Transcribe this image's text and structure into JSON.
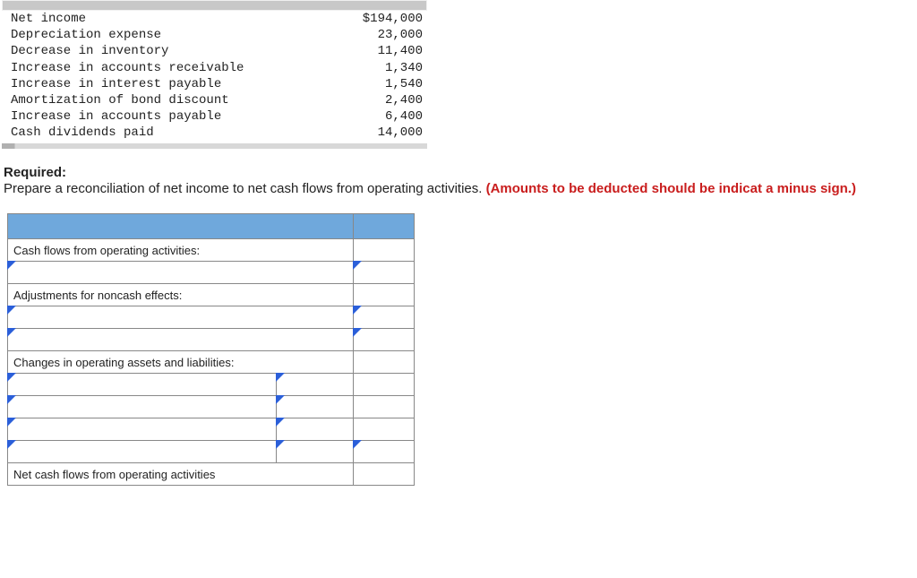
{
  "data_items": [
    {
      "label": "Net income",
      "value": "$194,000"
    },
    {
      "label": "Depreciation expense",
      "value": "23,000"
    },
    {
      "label": "Decrease in inventory",
      "value": "11,400"
    },
    {
      "label": "Increase in accounts receivable",
      "value": "1,340"
    },
    {
      "label": "Increase in interest payable",
      "value": "1,540"
    },
    {
      "label": "Amortization of bond discount",
      "value": "2,400"
    },
    {
      "label": "Increase in accounts payable",
      "value": "6,400"
    },
    {
      "label": "Cash dividends paid",
      "value": "14,000"
    }
  ],
  "required": {
    "heading": "Required:",
    "instruction_plain": "Prepare a reconciliation of net income to net cash flows from operating activities. ",
    "instruction_red": "(Amounts to be deducted should be indicat a minus sign.)"
  },
  "answer_table": {
    "rows": {
      "cash_flows": "Cash flows from operating activities:",
      "adjustments": "Adjustments for noncash effects:",
      "changes": "Changes in operating assets and liabilities:",
      "net_cash": "Net cash flows from operating activities"
    }
  }
}
